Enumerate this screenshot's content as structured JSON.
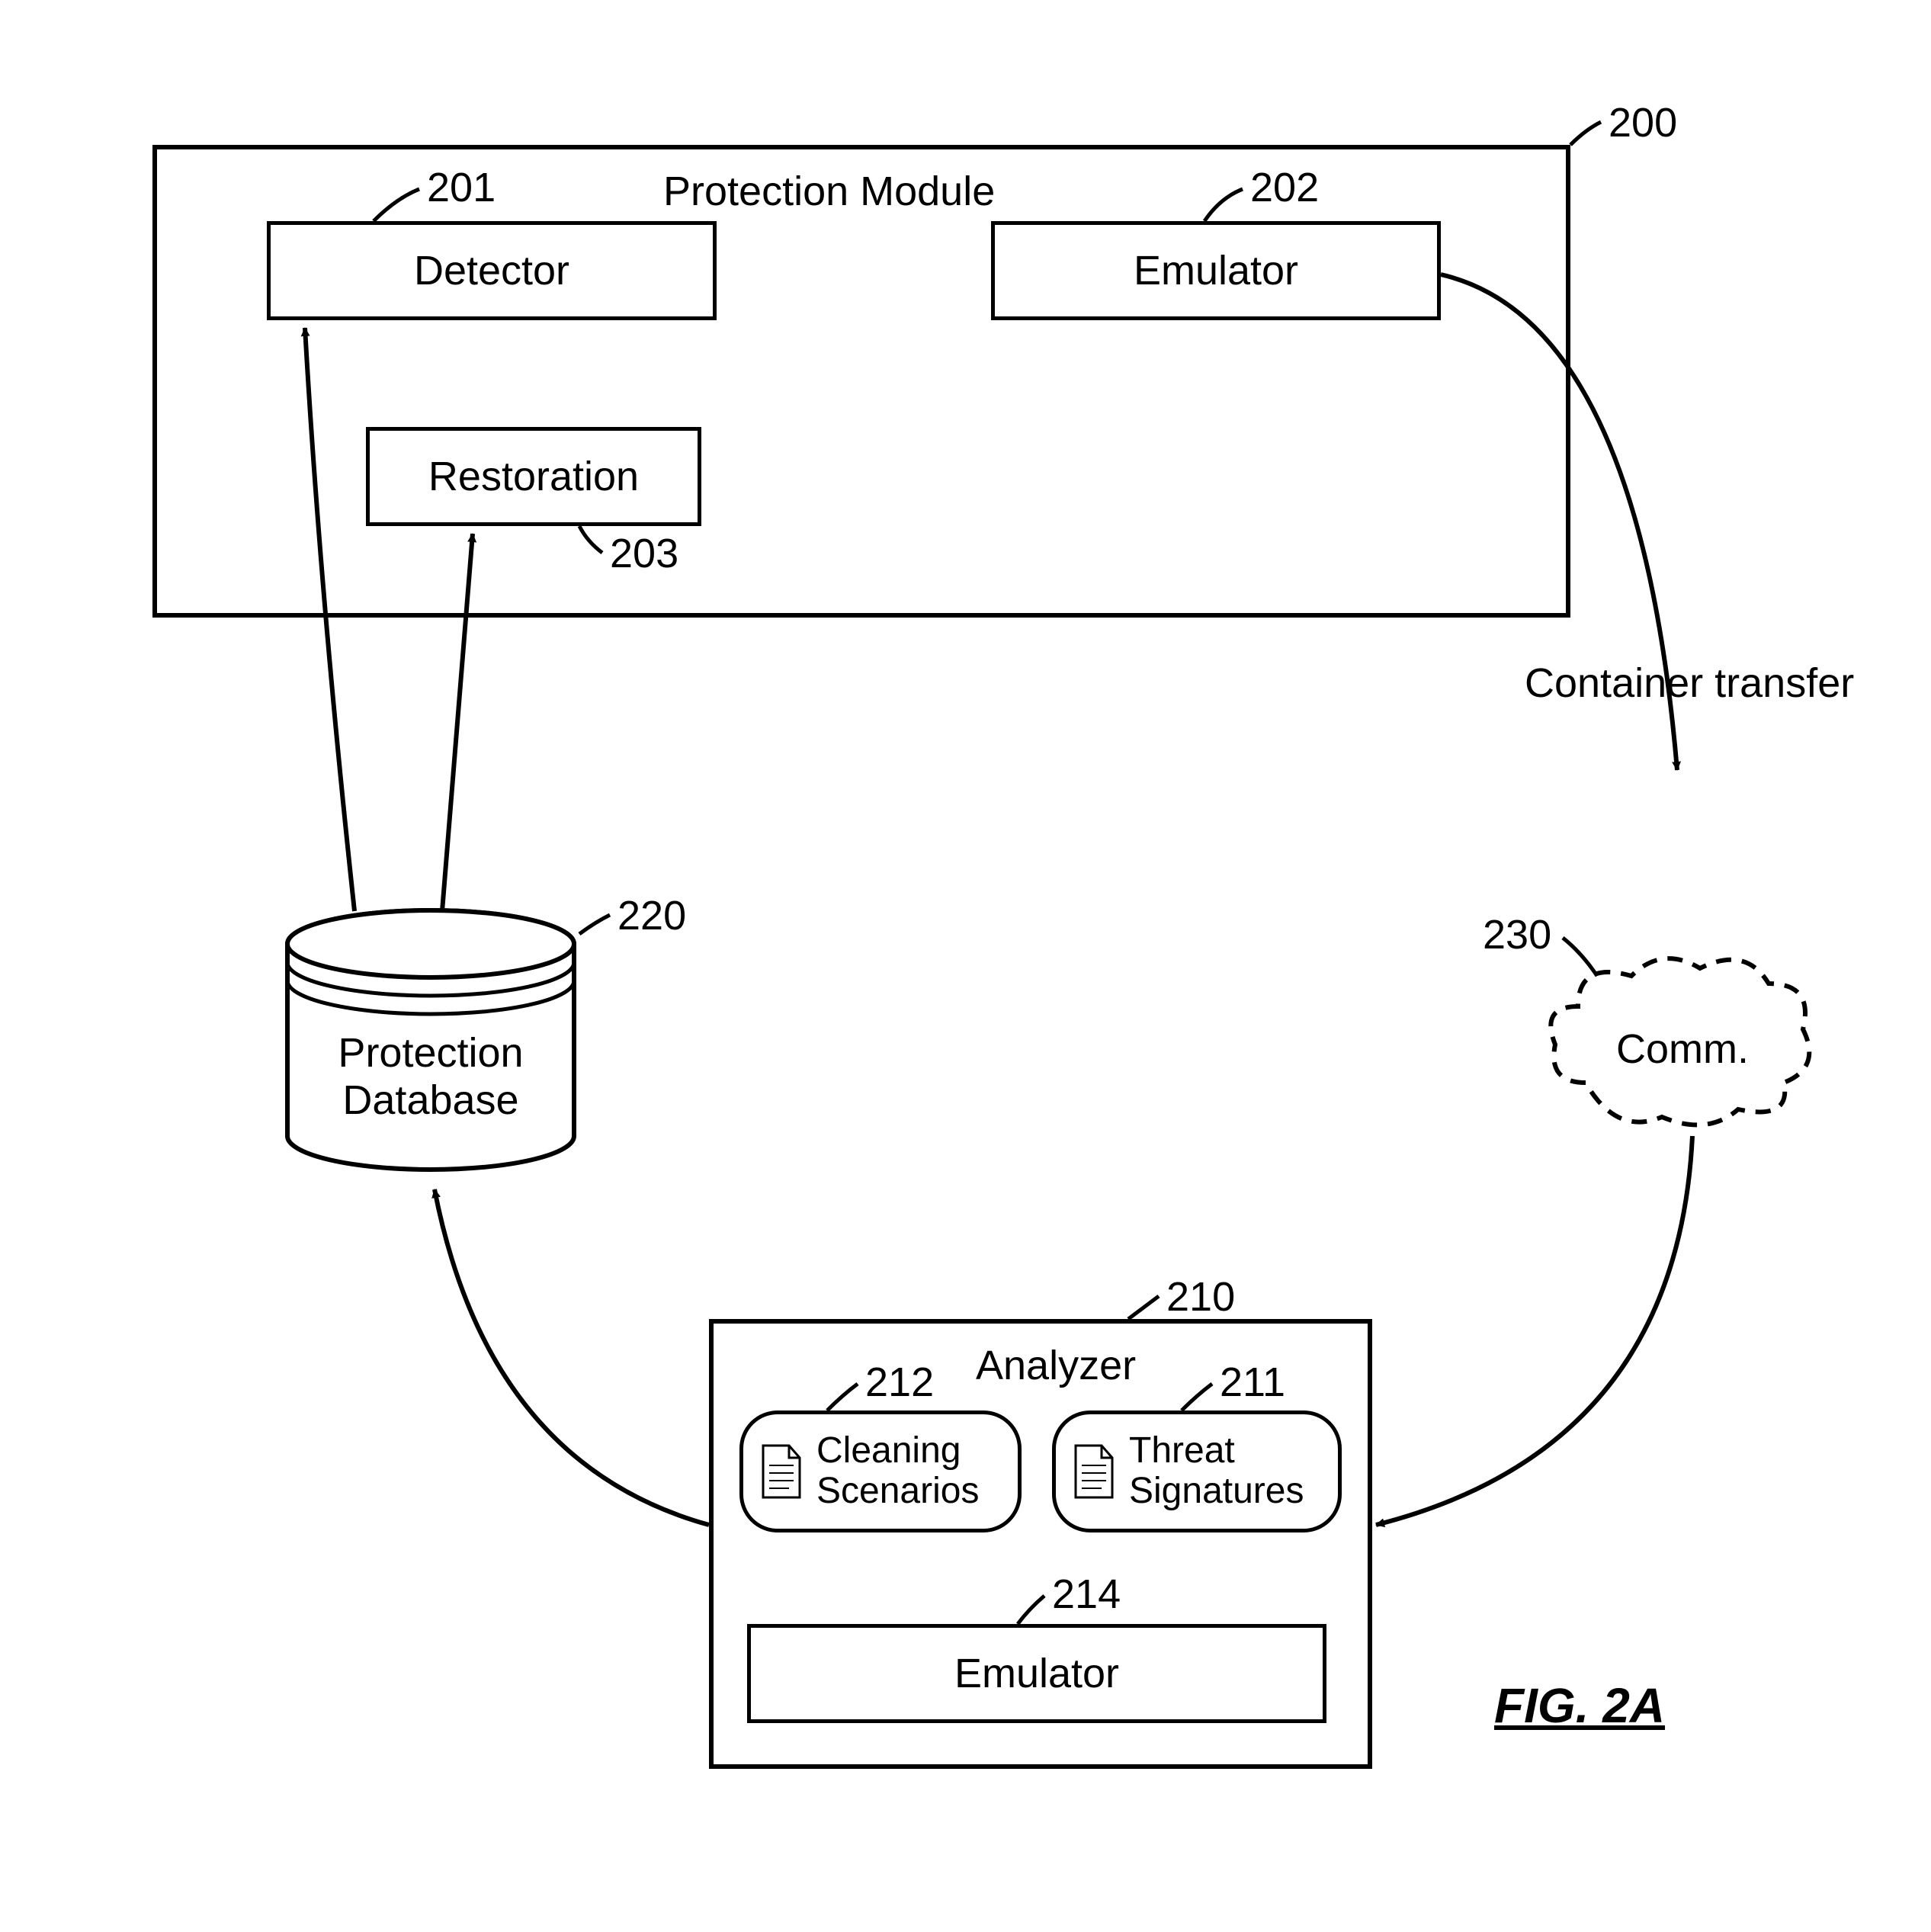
{
  "protectionModule": {
    "title": "Protection Module",
    "ref": "200",
    "detector": {
      "label": "Detector",
      "ref": "201"
    },
    "emulator": {
      "label": "Emulator",
      "ref": "202"
    },
    "restoration": {
      "label": "Restoration",
      "ref": "203"
    }
  },
  "database": {
    "label": "Protection\nDatabase",
    "ref": "220"
  },
  "comm": {
    "label": "Comm.",
    "ref": "230",
    "transferLabel": "Container transfer"
  },
  "analyzer": {
    "title": "Analyzer",
    "ref": "210",
    "cleaning": {
      "label": "Cleaning\nScenarios",
      "ref": "212"
    },
    "threat": {
      "label": "Threat\nSignatures",
      "ref": "211"
    },
    "emulator": {
      "label": "Emulator",
      "ref": "214"
    }
  },
  "figure": "FIG. 2A"
}
